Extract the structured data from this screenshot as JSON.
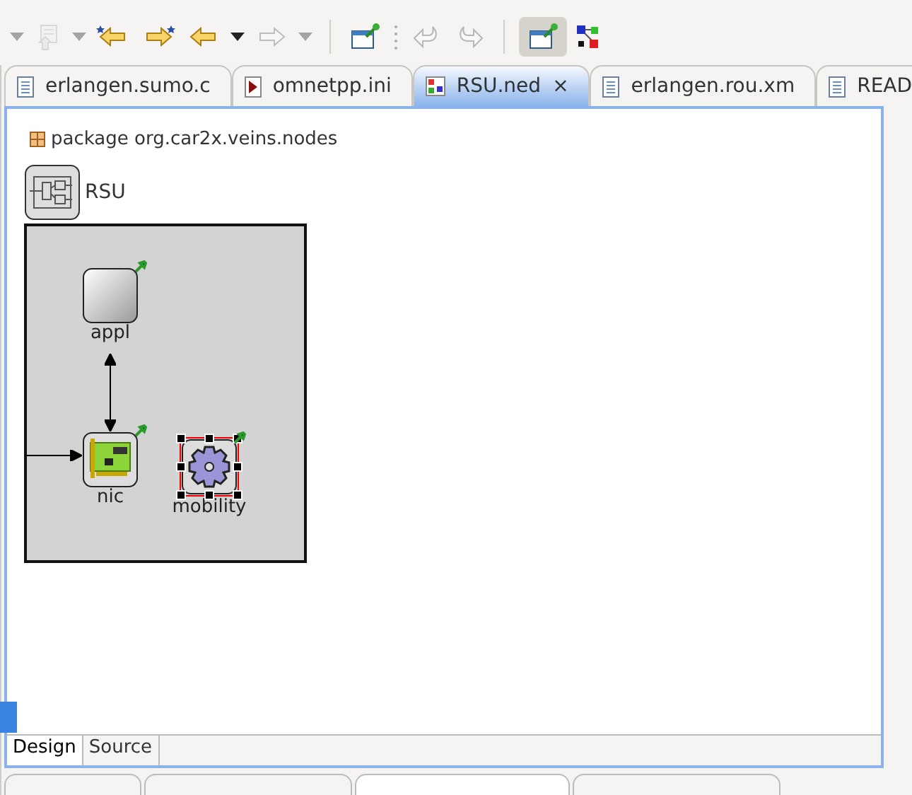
{
  "toolbar": [
    {
      "kind": "dropdown",
      "disabled": true
    },
    {
      "kind": "doc-up",
      "disabled": true
    },
    {
      "kind": "dropdown",
      "disabled": true
    },
    {
      "kind": "back-star",
      "disabled": false
    },
    {
      "kind": "forward-star",
      "disabled": false
    },
    {
      "kind": "back",
      "disabled": false
    },
    {
      "kind": "dropdown",
      "disabled": false
    },
    {
      "kind": "forward",
      "disabled": true
    },
    {
      "kind": "dropdown",
      "disabled": true
    },
    {
      "kind": "separator"
    },
    {
      "kind": "window-pin",
      "disabled": false,
      "pressed": false
    },
    {
      "kind": "dots"
    },
    {
      "kind": "undo",
      "disabled": true
    },
    {
      "kind": "redo",
      "disabled": true
    },
    {
      "kind": "separator"
    },
    {
      "kind": "window-pin",
      "disabled": false,
      "pressed": true
    },
    {
      "kind": "graph",
      "disabled": false
    }
  ],
  "tabs": [
    {
      "label": "erlangen.sumo.c",
      "kind": "text",
      "selected": false
    },
    {
      "label": "omnetpp.ini",
      "kind": "ini",
      "selected": false
    },
    {
      "label": "RSU.ned",
      "kind": "ned",
      "selected": true,
      "close": "×"
    },
    {
      "label": "erlangen.rou.xm",
      "kind": "text",
      "selected": false
    },
    {
      "label": "READ",
      "kind": "text",
      "selected": false
    }
  ],
  "package": "package org.car2x.veins.nodes",
  "module": {
    "name": "RSU",
    "submodules": [
      {
        "label": "appl",
        "kind": "blank",
        "selected": false
      },
      {
        "label": "nic",
        "kind": "card",
        "selected": false
      },
      {
        "label": "mobility",
        "kind": "gear",
        "selected": true
      }
    ]
  },
  "bottom_tabs": [
    {
      "label": "Design",
      "selected": true
    },
    {
      "label": "Source",
      "selected": false
    }
  ],
  "panel_tabs": [
    {
      "selected": false
    },
    {
      "selected": false
    },
    {
      "selected": true
    },
    {
      "selected": false
    }
  ]
}
